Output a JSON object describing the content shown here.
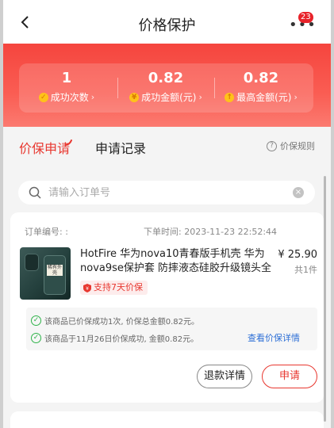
{
  "nav": {
    "title": "价格保护",
    "badge_count": "23"
  },
  "stats": [
    {
      "value": "1",
      "label": "成功次数",
      "icon": "coin-check-icon"
    },
    {
      "value": "0.82",
      "label": "成功金额(元)",
      "icon": "coin-yen-icon"
    },
    {
      "value": "0.82",
      "label": "最高金额(元)",
      "icon": "coin-up-icon"
    }
  ],
  "tabs": {
    "active": "价保申请",
    "inactive": "申请记录",
    "rules": "价保规则"
  },
  "search": {
    "placeholder": "请输入订单号"
  },
  "order": {
    "order_no_label": "订单编号: :",
    "order_time": "下单时间:  2023-11-23 22:52:44",
    "title": "HotFire 华为nova10青春版手机壳 华为nova9se保护套 防摔液态硅胶升级镜头全",
    "guarantee": "支持7天价保",
    "price": "¥ 25.90",
    "qty": "共1件",
    "info_1": "该商品已价保成功1次, 价保总金额0.82元。",
    "info_2": "该商品于11月26日价保成功, 金额0.82元。",
    "detail_link": "查看价保详情",
    "refund_button": "退款详情",
    "apply_button": "申请",
    "thumb_tag": "稀有外壳"
  },
  "colors": {
    "accent": "#e8372f",
    "hero_top": "#f5453e",
    "link": "#2d6fd6",
    "success": "#2fb34a"
  }
}
